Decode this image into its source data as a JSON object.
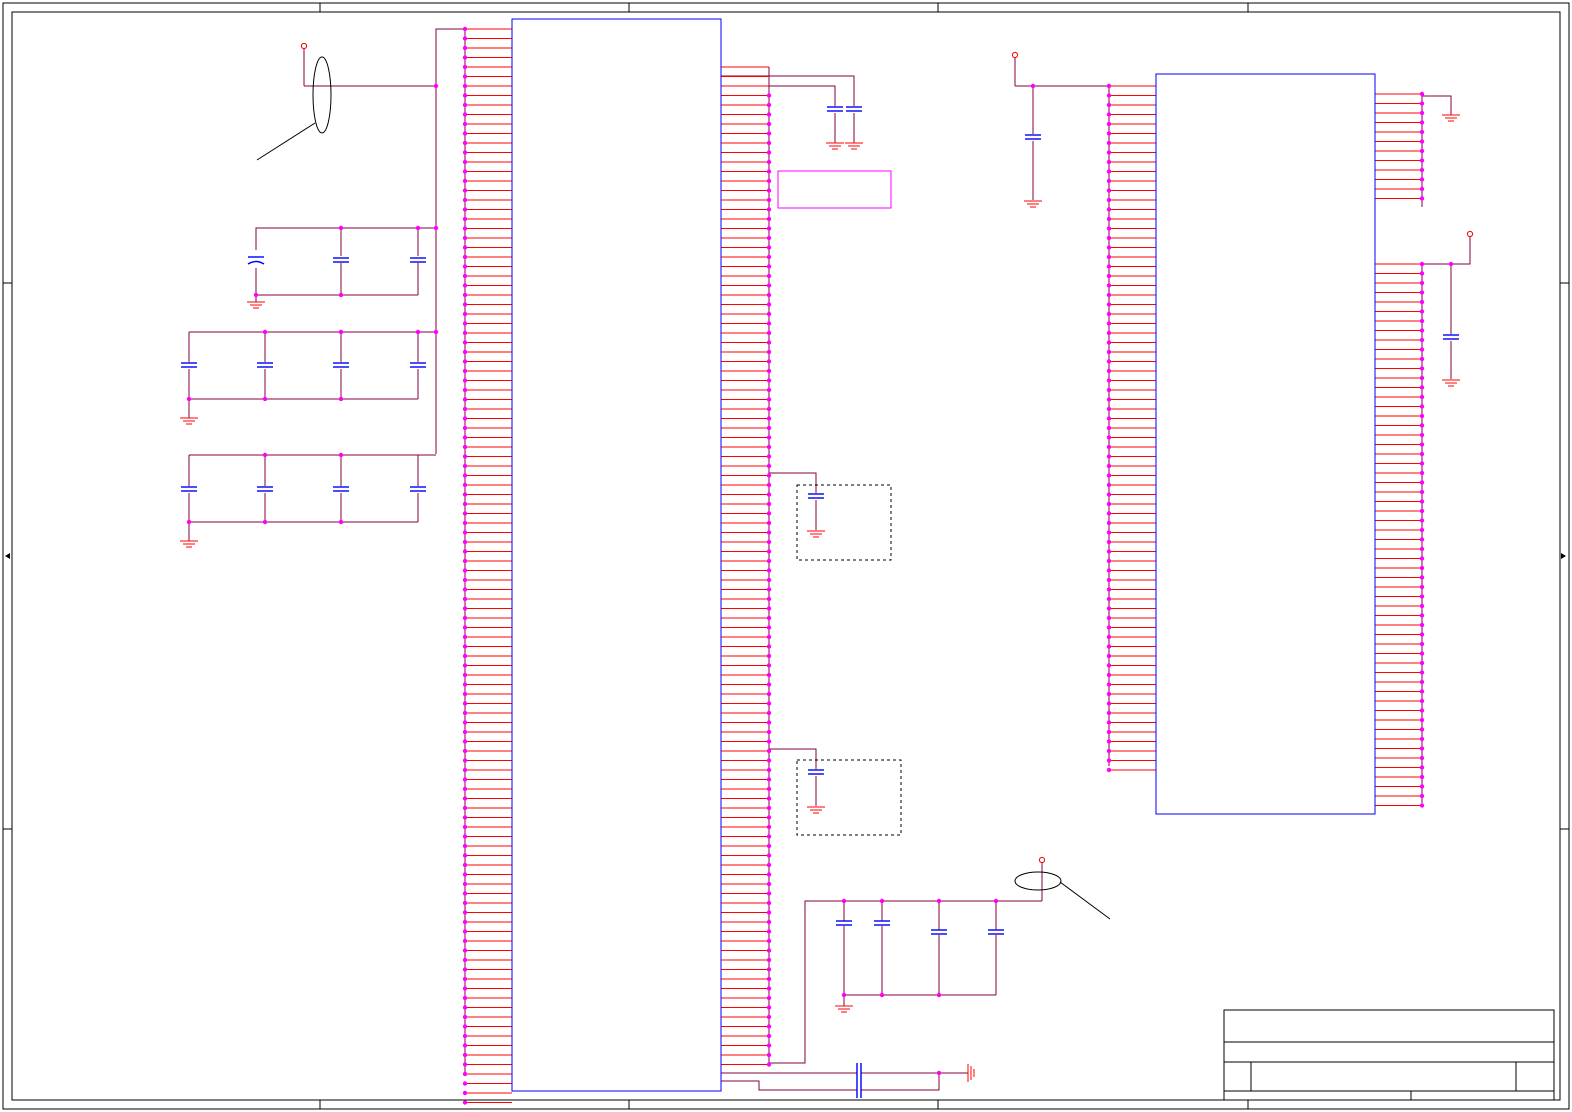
{
  "sheet": {
    "title_block": {
      "title": "",
      "size": "",
      "document_number": "",
      "revision": "",
      "date": "",
      "sheet_number": ""
    }
  },
  "colors": {
    "frame": "#000000",
    "pin": "#ff0000",
    "wire": "#800040",
    "component": "#0000ff",
    "junction": "#ff00ff",
    "power": "#ff0000",
    "keepout_box": "#ff00ff",
    "note": "#000000"
  },
  "components": {
    "u1": {
      "left_pins": 114,
      "right_pins": 106
    },
    "u2": {
      "left_pins": 73,
      "right_pins": 75
    }
  },
  "icons": [
    "power-port-icon",
    "ground-icon",
    "capacitor-icon",
    "electrolytic-capacitor-icon",
    "junction-dot-icon"
  ]
}
